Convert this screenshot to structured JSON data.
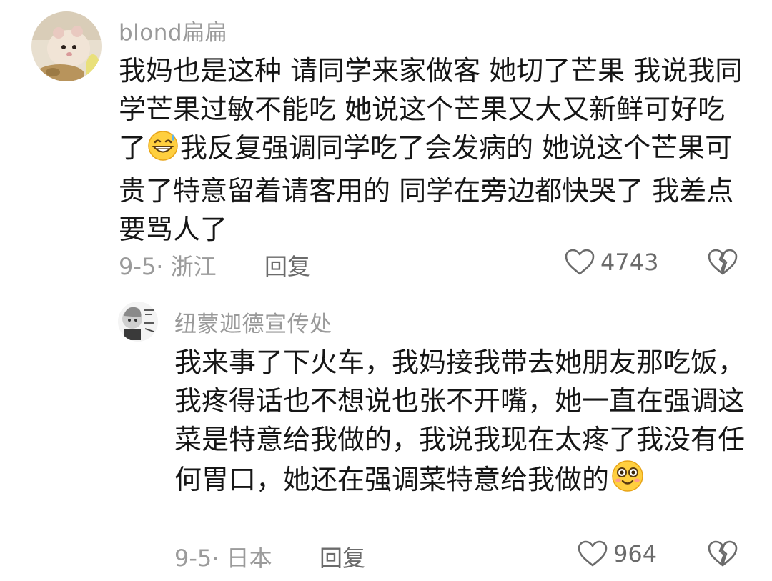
{
  "comments": [
    {
      "username": "blond扁扁",
      "text_before_emoji": "我妈也是这种 请同学来家做客 她切了芒果 我说我同学芒果过敏不能吃 她说这个芒果又大又新鲜可好吃了",
      "emoji": "grinning-sweat-emoji",
      "text_after_emoji": "我反复强调同学吃了会发病的 她说这个芒果可贵了特意留着请客用的 同学在旁边都快哭了 我差点要骂人了",
      "date_location": "9-5· 浙江",
      "reply_label": "回复",
      "likes": "4743"
    },
    {
      "username": "纽蒙迦德宣传处",
      "text_before_emoji": "我来事了下火车，我妈接我带去她朋友那吃饭，我疼得话也不想说也张不开嘴，她一直在强调这菜是特意给我做的，我说我现在太疼了我没有任何胃口，她还在强调菜特意给我做的",
      "emoji": "flushed-smile-emoji",
      "text_after_emoji": "",
      "date_location": "9-5· 日本",
      "reply_label": "回复",
      "likes": "964"
    }
  ],
  "colors": {
    "text": "#161616",
    "username": "#9a9a9a",
    "meta": "#9b9b9b",
    "action": "#6b6b6b",
    "background": "#ffffff"
  }
}
